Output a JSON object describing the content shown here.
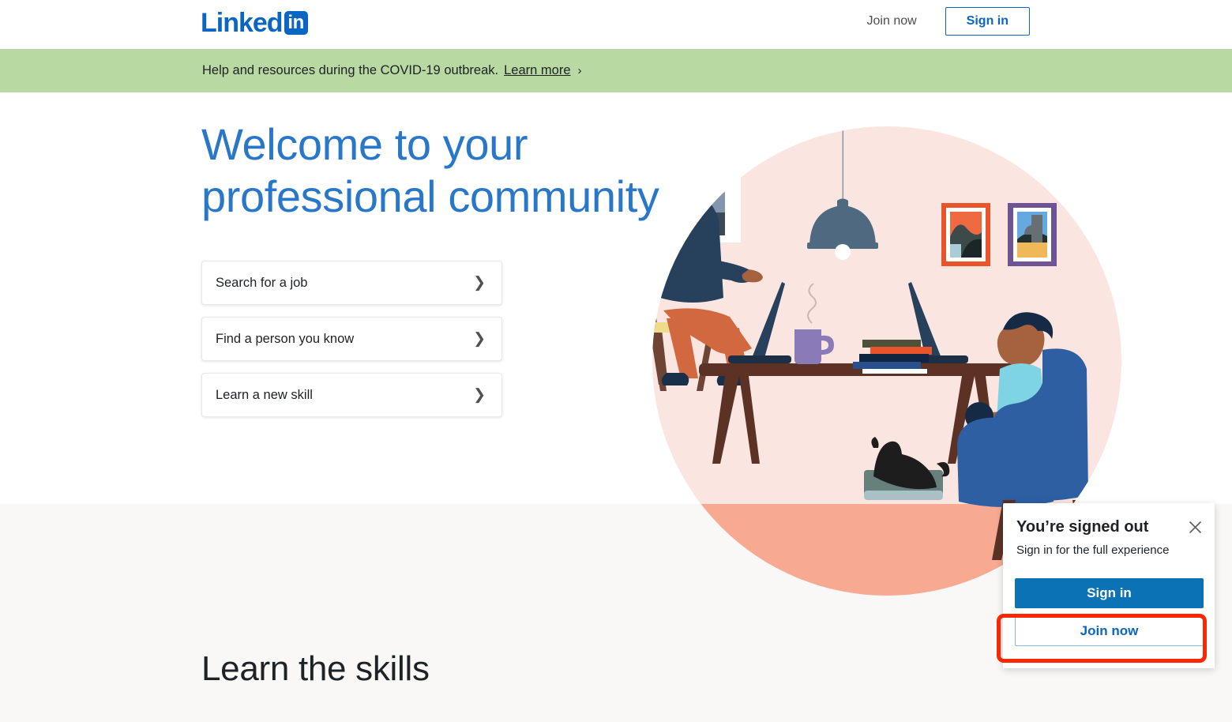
{
  "header": {
    "logo_word": "Linked",
    "logo_badge": "in",
    "join_now_label": "Join now",
    "sign_in_label": "Sign in"
  },
  "banner": {
    "text": "Help and resources during the COVID-19 outbreak.",
    "link_label": "Learn more",
    "chevron": "›",
    "background_color": "#b8d9a1"
  },
  "hero": {
    "title": "Welcome to your professional community",
    "title_color": "#2977c9",
    "cta_items": [
      {
        "label": "Search for a job",
        "chevron": "❯"
      },
      {
        "label": "Find a person you know",
        "chevron": "❯"
      },
      {
        "label": "Learn a new skill",
        "chevron": "❯"
      }
    ]
  },
  "illustration": {
    "name": "two-people-working-at-desk-illustration",
    "background_circle_color": "#fbe5e0",
    "floor_circle_color": "#f7a992",
    "lamp_color": "#4f6a80",
    "desk_color": "#5c3224",
    "armchair_color": "#2e5fa3",
    "frame_left_color": "#e9542a",
    "frame_right_color": "#6f5495"
  },
  "lower_section": {
    "title": "Learn the skills",
    "background_color": "#f9f8f6"
  },
  "popup": {
    "title": "You’re signed out",
    "subtitle": "Sign in for the full experience",
    "sign_in_label": "Sign in",
    "join_now_label": "Join now",
    "close_icon": "close-icon",
    "sign_in_color": "#0a72b5",
    "join_now_color": "#0a66c2"
  },
  "annotation": {
    "highlight_color": "#fc2600",
    "target": "join-now-button"
  }
}
